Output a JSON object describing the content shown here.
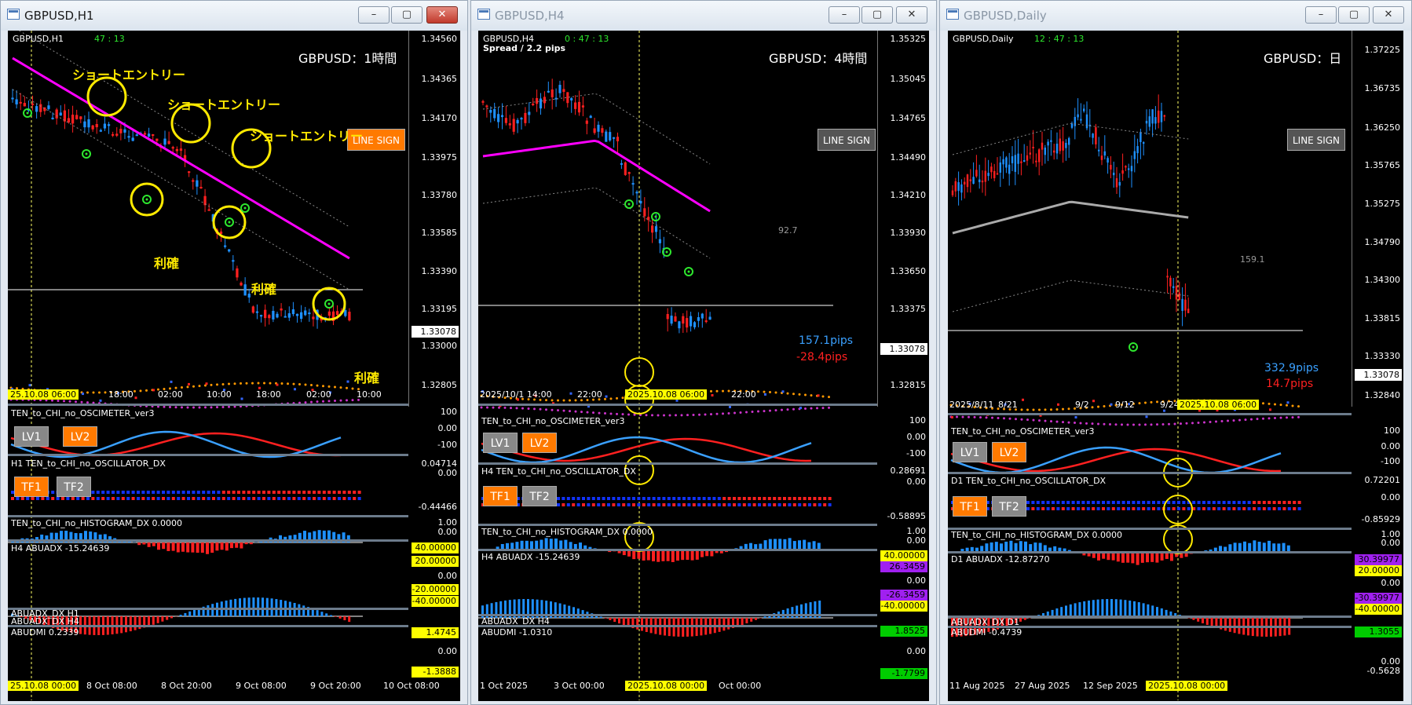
{
  "windows": [
    {
      "title": "GBPUSD,H1",
      "symbol": "GBPUSD,H1",
      "clock": "47 : 13",
      "timeframe_label": "GBPUSD：1時間",
      "line_sign": "LINE SIGN",
      "prices": [
        "1.34560",
        "1.34365",
        "1.34170",
        "1.33975",
        "1.33780",
        "1.33585",
        "1.33390",
        "1.33195",
        "1.33000",
        "1.32805"
      ],
      "current_price": "1.33078",
      "time_labels": [
        "18:00",
        "02:00",
        "10:00",
        "18:00",
        "02:00",
        "10:00"
      ],
      "time_highlight": "25.10.08 06:00",
      "annotations": [
        "ショートエントリー",
        "ショートエントリー",
        "ショートエントリー",
        "利確",
        "利確",
        "利確"
      ],
      "ind1": {
        "name": "TEN_to_CHI_no_OSCIMETER_ver3",
        "scale": [
          "100",
          "0.00",
          "-100"
        ],
        "lv1": "LV1",
        "lv2": "LV2"
      },
      "ind2": {
        "name": "H1 TEN_to_CHI_no_OSCILLATOR_DX",
        "top": "0.04714",
        "zero": "0.00",
        "bottom": "-0.44466",
        "tf1": "TF1",
        "tf2": "TF2"
      },
      "ind3": {
        "name": "TEN_to_CHI_no_HISTOGRAM_DX 0.0000",
        "scale": [
          "1.00",
          "0.00"
        ]
      },
      "ind4": {
        "name": "H4 ABUADX -15.24639",
        "scale": [
          "40.00000",
          "20.00000",
          "0.00",
          "-20.00000",
          "-40.00000"
        ]
      },
      "ind5": {
        "name": "ABUADX_DX H1",
        "name2": "ABUADX_DX H4"
      },
      "ind6": {
        "name": "ABUDMI 0.2339",
        "top": "1.4745",
        "zero": "0.00",
        "bottom": "-1.3888"
      },
      "bottom_time": [
        "8 Oct 08:00",
        "8 Oct 20:00",
        "9 Oct 08:00",
        "9 Oct 20:00",
        "10 Oct 08:00"
      ],
      "bottom_highlight": "25.10.08 00:00"
    },
    {
      "title": "GBPUSD,H4",
      "symbol": "GBPUSD,H4",
      "clock": "0 : 47 : 13",
      "spread": "Spread / 2.2 pips",
      "timeframe_label": "GBPUSD：4時間",
      "line_sign": "LINE SIGN",
      "prices": [
        "1.35325",
        "1.35045",
        "1.34765",
        "1.34490",
        "1.34210",
        "1.33930",
        "1.33650",
        "1.33375",
        "1.33078",
        "1.32815"
      ],
      "current_price": "1.33078",
      "gray_value": "92.7",
      "pips_blue": "157.1pips",
      "pips_red": "-28.4pips",
      "time_labels": [
        "2025/10/1 14:00",
        "22:00",
        "22:00"
      ],
      "time_highlight": "2025.10.08 06:00",
      "ind1": {
        "name": "TEN_to_CHI_no_OSCIMETER_ver3",
        "scale": [
          "100",
          "0.00",
          "-100"
        ],
        "lv1": "LV1",
        "lv2": "LV2"
      },
      "ind2": {
        "name": "H4 TEN_to_CHI_no_OSCILLATOR_DX",
        "top": "0.28691",
        "zero": "0.00",
        "bottom": "-0.58895",
        "tf1": "TF1",
        "tf2": "TF2"
      },
      "ind3": {
        "name": "TEN_to_CHI_no_HISTOGRAM_DX 0.0000",
        "scale": [
          "1.00",
          "0.00"
        ]
      },
      "ind4": {
        "name": "H4 ABUADX -15.24639",
        "scale": [
          "40.00000",
          "26.3459",
          "0.00",
          "-26.3459",
          "-40.00000"
        ]
      },
      "ind5": {
        "name": "ABUADX_DX H4"
      },
      "ind6": {
        "name": "ABUDMI -1.0310",
        "top": "1.8525",
        "zero": "0.00",
        "bottom": "-1.7799"
      },
      "bottom_time": [
        "1 Oct 2025",
        "3 Oct 00:00",
        "Oct 00:00"
      ],
      "bottom_highlight": "2025.10.08 00:00"
    },
    {
      "title": "GBPUSD,Daily",
      "symbol": "GBPUSD,Daily",
      "clock": "12 : 47 : 13",
      "timeframe_label": "GBPUSD：日",
      "line_sign": "LINE SIGN",
      "prices": [
        "1.37225",
        "1.36735",
        "1.36250",
        "1.35765",
        "1.35275",
        "1.34790",
        "1.34300",
        "1.33815",
        "1.33330",
        "1.32840"
      ],
      "current_price": "1.33078",
      "gray_value": "159.1",
      "pips_blue": "332.9pips",
      "pips_red": "14.7pips",
      "time_labels": [
        "2025/8/11",
        "8/21",
        "9/2",
        "9/12",
        "9/24"
      ],
      "time_highlight": "2025.10.08 06:00",
      "ind1": {
        "name": "TEN_to_CHI_no_OSCIMETER_ver3",
        "scale": [
          "100",
          "0.00",
          "-100"
        ],
        "lv1": "LV1",
        "lv2": "LV2"
      },
      "ind2": {
        "name": "D1 TEN_to_CHI_no_OSCILLATOR_DX",
        "top": "0.72201",
        "zero": "0.00",
        "bottom": "-0.85929",
        "tf1": "TF1",
        "tf2": "TF2"
      },
      "ind3": {
        "name": "TEN_to_CHI_no_HISTOGRAM_DX 0.0000",
        "scale": [
          "1.00",
          "0.00"
        ]
      },
      "ind4": {
        "name": "D1 ABUADX -12.87270",
        "scale": [
          "40.00000",
          "30.39977",
          "20.00000",
          "0.00",
          "-20.00000",
          "-30.39977",
          "-40.00000"
        ]
      },
      "ind5": {
        "name": "ABUADX_DX D1"
      },
      "ind6": {
        "name": "ABUDMI -0.4739",
        "top": "1.3055",
        "zero": "0.00",
        "bottom": "-0.5628"
      },
      "bottom_time": [
        "11 Aug 2025",
        "27 Aug 2025",
        "12 Sep 2025"
      ],
      "bottom_highlight": "2025.10.08 00:00"
    }
  ],
  "colors": {
    "bull": "#1e90ff",
    "bear": "#ff2020",
    "ma": "#ff00ff",
    "cyan": "#22d3d3",
    "highlight": "#ffff00",
    "orange": "#ff7a00",
    "bg": "#000000"
  },
  "window_controls": {
    "minimize": "–",
    "maximize": "▢",
    "close": "✕"
  }
}
